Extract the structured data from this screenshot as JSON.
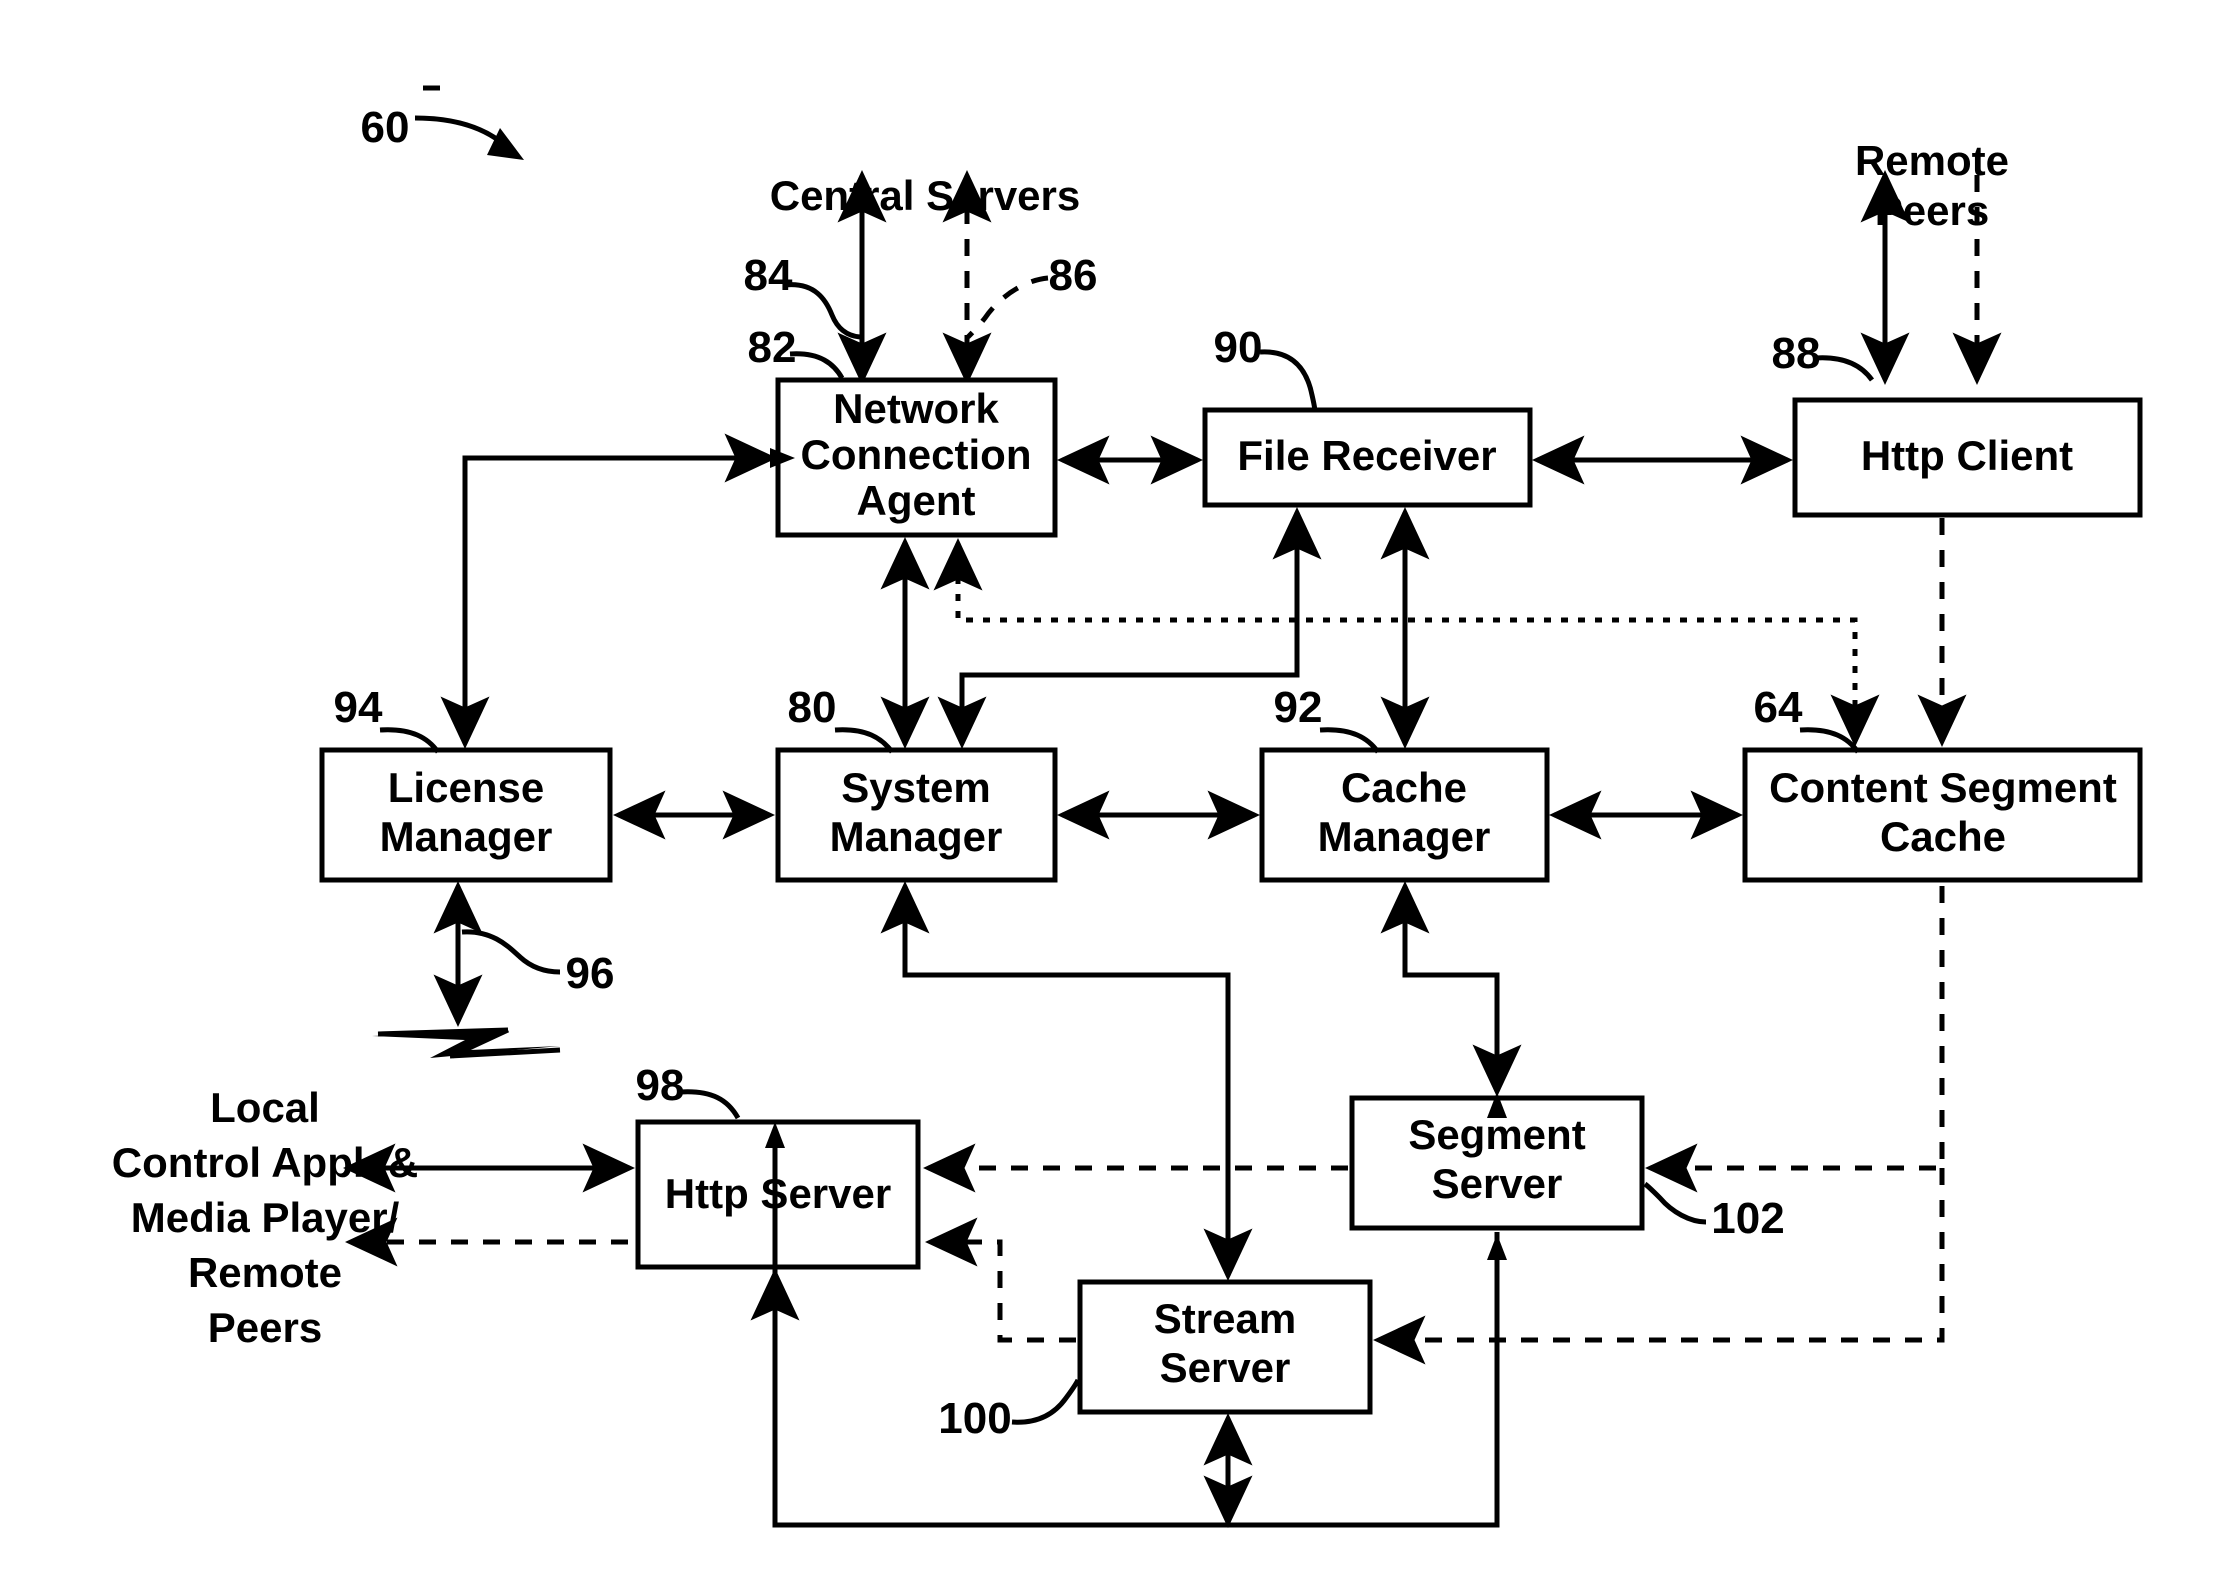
{
  "figure": {
    "figure_ref": "60",
    "boxes": [
      {
        "id": "network_connection_agent",
        "label_lines": [
          "Network",
          "Connection",
          "Agent"
        ],
        "ref": "82"
      },
      {
        "id": "file_receiver",
        "label_lines": [
          "File Receiver"
        ],
        "ref": "90"
      },
      {
        "id": "http_client",
        "label_lines": [
          "Http Client"
        ],
        "ref": "88"
      },
      {
        "id": "license_manager",
        "label_lines": [
          "License",
          "Manager"
        ],
        "ref": "94"
      },
      {
        "id": "system_manager",
        "label_lines": [
          "System",
          "Manager"
        ],
        "ref": "80"
      },
      {
        "id": "cache_manager",
        "label_lines": [
          "Cache",
          "Manager"
        ],
        "ref": "92"
      },
      {
        "id": "content_segment_cache",
        "label_lines": [
          "Content Segment",
          "Cache"
        ],
        "ref": "64"
      },
      {
        "id": "http_server",
        "label_lines": [
          "Http Server"
        ],
        "ref": "98"
      },
      {
        "id": "stream_server",
        "label_lines": [
          "Stream",
          "Server"
        ],
        "ref": "100"
      },
      {
        "id": "segment_server",
        "label_lines": [
          "Segment",
          "Server"
        ],
        "ref": "102"
      }
    ],
    "external_labels": [
      {
        "id": "central_servers",
        "lines": [
          "Central Servers"
        ]
      },
      {
        "id": "remote_peers_top",
        "lines": [
          "Remote",
          "Peers"
        ]
      },
      {
        "id": "local_clients",
        "lines": [
          "Local",
          "Control Appl. &",
          "Media Player/",
          "Remote",
          "Peers"
        ]
      }
    ],
    "reference_numerals": [
      "60",
      "82",
      "84",
      "86",
      "88",
      "90",
      "92",
      "94",
      "96",
      "98",
      "100",
      "102",
      "64",
      "80"
    ],
    "box_text": {
      "network_connection_agent_l1": "Network",
      "network_connection_agent_l2": "Connection",
      "network_connection_agent_l3": "Agent",
      "file_receiver": "File Receiver",
      "http_client": "Http Client",
      "license_manager_l1": "License",
      "license_manager_l2": "Manager",
      "system_manager_l1": "System",
      "system_manager_l2": "Manager",
      "cache_manager_l1": "Cache",
      "cache_manager_l2": "Manager",
      "content_segment_cache_l1": "Content Segment",
      "content_segment_cache_l2": "Cache",
      "http_server": "Http Server",
      "stream_server_l1": "Stream",
      "stream_server_l2": "Server",
      "segment_server_l1": "Segment",
      "segment_server_l2": "Server"
    },
    "external_text": {
      "central_servers": "Central Servers",
      "remote_peers_l1": "Remote",
      "remote_peers_l2": "Peers",
      "local_l1": "Local",
      "local_l2": "Control Appl. &",
      "local_l3": "Media Player/",
      "local_l4": "Remote",
      "local_l5": "Peers"
    },
    "numerals": {
      "n60": "60",
      "n82": "82",
      "n84": "84",
      "n86": "86",
      "n88": "88",
      "n90": "90",
      "n92": "92",
      "n94": "94",
      "n96": "96",
      "n98": "98",
      "n100": "100",
      "n102": "102",
      "n64": "64",
      "n80": "80"
    },
    "colors": {
      "ink": "#000000",
      "paper": "#ffffff"
    }
  }
}
